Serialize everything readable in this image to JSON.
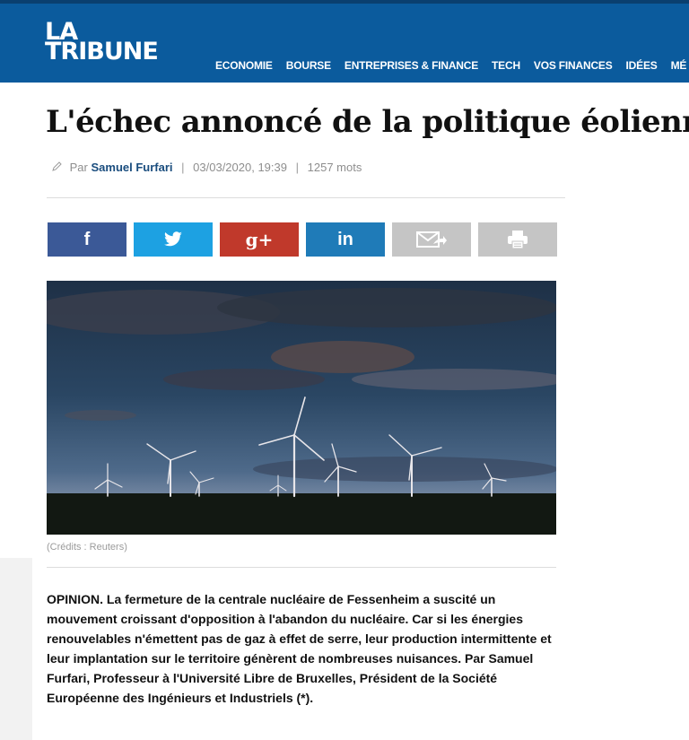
{
  "site": {
    "logo_line1": "LA",
    "logo_line2": "TRIBUNE"
  },
  "nav": {
    "items": [
      "ECONOMIE",
      "BOURSE",
      "ENTREPRISES & FINANCE",
      "TECH",
      "VOS FINANCES",
      "IDÉES",
      "MÉ"
    ]
  },
  "article": {
    "title": "L'échec annoncé de la politique éolienne",
    "byline_prefix": "Par",
    "author": "Samuel Furfari",
    "date": "03/03/2020, 19:39",
    "separator": "|",
    "word_count": "1257 mots",
    "credits": "(Crédits : Reuters)",
    "intro": "OPINION. La fermeture de la centrale nucléaire de Fessenheim a suscité un mouvement croissant d'opposition à l'abandon du nucléaire. Car si les énergies renouvelables n'émettent pas de gaz à effet de serre, leur production intermittente et leur implantation sur le territoire génèrent de nombreuses nuisances. Par Samuel Furfari, Professeur à l'Université Libre de Bruxelles, Président de la Société Européenne des Ingénieurs et Industriels (*)."
  },
  "share": {
    "facebook_label": "f",
    "googleplus_label": "g+",
    "linkedin_label": "in",
    "icons": [
      "facebook-icon",
      "twitter-icon",
      "googleplus-icon",
      "linkedin-icon",
      "email-icon",
      "print-icon"
    ]
  },
  "colors": {
    "header_blue": "#0b5b9d",
    "facebook": "#3b5997",
    "twitter": "#1da1e2",
    "googleplus": "#c0392b",
    "linkedin": "#1f7bb8",
    "gray_button": "#c5c5c5",
    "author_blue": "#1a4d7e"
  }
}
